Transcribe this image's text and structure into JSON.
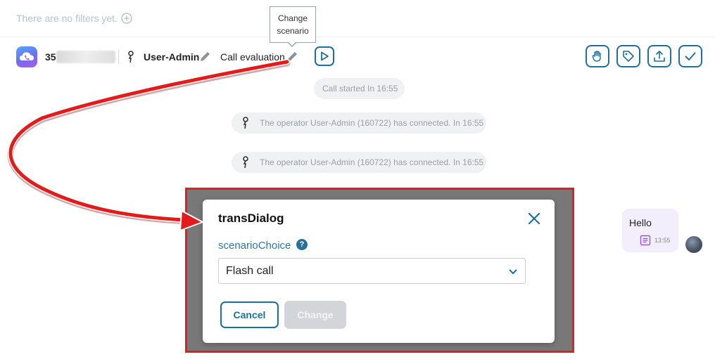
{
  "filters": {
    "empty_text": "There are no filters yet."
  },
  "header": {
    "phone_visible": "35",
    "user_name": "User-Admin",
    "scenario_name": "Call evaluation"
  },
  "tooltip": {
    "line1": "Change",
    "line2": "scenario"
  },
  "chat": {
    "system_messages": [
      "Call started In 16:55",
      "The operator User-Admin (160722) has connected. In 16:55",
      "The operator User-Admin (160722) has connected. In 16:55"
    ],
    "incoming_message": {
      "text": "Hello",
      "time": "13:55"
    }
  },
  "dialog": {
    "title": "transDialog",
    "field_label": "scenarioChoice",
    "help_glyph": "?",
    "selected_value": "Flash call",
    "cancel_label": "Cancel",
    "change_label": "Change"
  },
  "colors": {
    "accent": "#1f6f9e",
    "annotation_red": "#e02020",
    "disabled_button": "#d3d5d8",
    "bubble": "#f3eefc"
  }
}
